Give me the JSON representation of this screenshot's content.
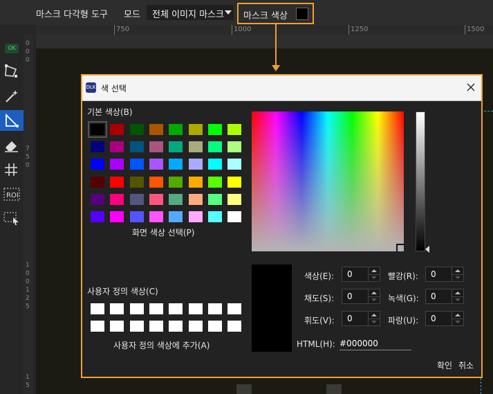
{
  "toolbar": {
    "tool_name": "마스크 다각형 도구",
    "mode_label": "모드",
    "mode_value": "전체 이미지 마스크",
    "mask_color_label": "마스크 색상",
    "mask_color": "#000000",
    "highlight_color": "#f0a030"
  },
  "ruler": {
    "ticks": [
      "750",
      "1000",
      "1250",
      "1500"
    ]
  },
  "vertical_ruler_digits": [
    "0",
    "0",
    "0",
    "7",
    "5",
    "0",
    "1",
    "0",
    "0",
    "1",
    "2",
    "5",
    "1",
    "5",
    "0"
  ],
  "left_panel": {
    "ok_badge": "OK",
    "roi_label": "ROI"
  },
  "dialog": {
    "title": "색 선택",
    "app_icon_text": "DLK",
    "basic_colors_label": "기본 색상(B)",
    "basic_colors": [
      "#000000",
      "#aa0000",
      "#005500",
      "#aa5500",
      "#00aa00",
      "#aaaa00",
      "#00ff00",
      "#aaff00",
      "#00007f",
      "#aa007f",
      "#00557f",
      "#aa557f",
      "#00aa7f",
      "#aaaa7f",
      "#00ff7f",
      "#aaff7f",
      "#0000ff",
      "#aa00ff",
      "#0055ff",
      "#aa55ff",
      "#00aaff",
      "#aaaaff",
      "#00ffff",
      "#aaffff",
      "#550000",
      "#ff0000",
      "#555500",
      "#ff5500",
      "#55aa00",
      "#ffaa00",
      "#55ff00",
      "#ffff00",
      "#55007f",
      "#ff007f",
      "#55557f",
      "#ff557f",
      "#55aa7f",
      "#ffaa7f",
      "#55ff7f",
      "#ffff7f",
      "#5500ff",
      "#ff00ff",
      "#5555ff",
      "#ff55ff",
      "#55aaff",
      "#ffaaff",
      "#55ffff",
      "#ffffff"
    ],
    "pick_screen_color": "화면 색상 선택(P)",
    "custom_colors_label": "사용자 정의 색상(C)",
    "add_to_custom": "사용자 정의 색상에 추가(A)",
    "fields": {
      "hue": {
        "label": "색상(E):",
        "value": "0"
      },
      "sat": {
        "label": "채도(S):",
        "value": "0"
      },
      "val": {
        "label": "휘도(V):",
        "value": "0"
      },
      "red": {
        "label": "빨강(R):",
        "value": "0"
      },
      "green": {
        "label": "녹색(G):",
        "value": "0"
      },
      "blue": {
        "label": "파랑(U):",
        "value": "0"
      }
    },
    "html_label": "HTML(H):",
    "html_value": "#000000",
    "ok": "확인",
    "cancel": "취소"
  }
}
